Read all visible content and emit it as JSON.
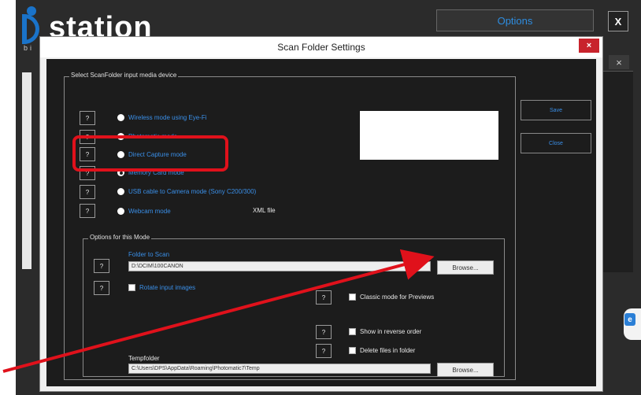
{
  "app": {
    "logo_text": "station",
    "logo_sub": "bi",
    "options_label": "Options",
    "close_label": "X",
    "bg_close_label": "×"
  },
  "dialog": {
    "title": "Scan Folder Settings",
    "close_label": "×",
    "media_group_label": "Select ScanFolder input media device",
    "help_label": "?",
    "modes": [
      {
        "label": "Wireless mode using Eye-Fi",
        "selected": false
      },
      {
        "label": "Photomatic mode",
        "selected": false
      },
      {
        "label": "Direct Capture mode",
        "selected": false
      },
      {
        "label": "Memory Card mode",
        "selected": true
      },
      {
        "label": "USB cable to Camera mode (Sony C200/300)",
        "selected": false
      },
      {
        "label": "Webcam mode",
        "selected": false
      }
    ],
    "xml_file_label": "XML file",
    "save_label": "Save",
    "close_button_label": "Close",
    "options_group_label": "Options for this Mode",
    "folder_to_scan_label": "Folder to Scan",
    "folder_to_scan_value": "D:\\DCIM\\100CANON",
    "browse_label": "Browse...",
    "rotate_label": "Rotate input images",
    "classic_label": "Classic mode for Previews",
    "reverse_label": "Show in reverse order",
    "delete_label": "Delete files in folder",
    "tempfolder_label": "Tempfolder",
    "tempfolder_value": "C:\\Users\\DPS\\AppData\\Roaming\\Photomatic7\\Temp"
  },
  "colors": {
    "accent_blue": "#3a8fe8",
    "highlight_red": "#e0111b",
    "dialog_bg": "#1c1c1c"
  }
}
